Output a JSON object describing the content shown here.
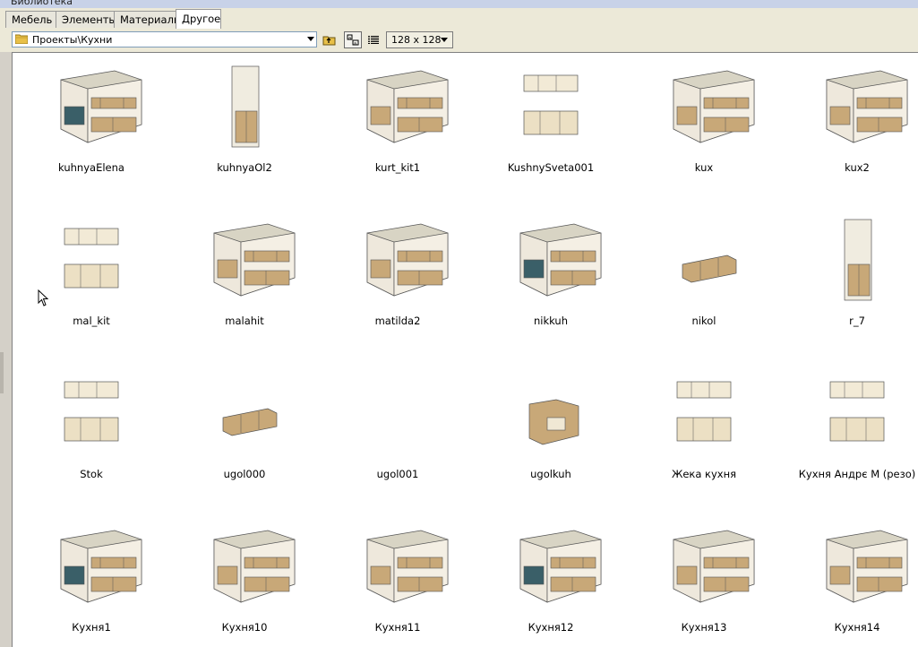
{
  "window": {
    "title": "Библиотека"
  },
  "tabs": [
    {
      "label": "Мебель",
      "active": false
    },
    {
      "label": "Элементы",
      "active": false
    },
    {
      "label": "Материалы",
      "active": false
    },
    {
      "label": "Другое",
      "active": true
    }
  ],
  "toolbar": {
    "path": "Проекты\\Кухни",
    "view_size": "128 x 128",
    "buttons": [
      {
        "icon": "folder-up-icon"
      },
      {
        "icon": "large-icons-view-icon",
        "pressed": true
      },
      {
        "icon": "list-view-icon"
      }
    ]
  },
  "items": [
    {
      "label": "kuhnyaElena"
    },
    {
      "label": "kuhnyaOl2"
    },
    {
      "label": "kurt_kit1"
    },
    {
      "label": "KushnySveta001"
    },
    {
      "label": "kux"
    },
    {
      "label": "kux2"
    },
    {
      "label": "mal_kit"
    },
    {
      "label": "malahit"
    },
    {
      "label": "matilda2"
    },
    {
      "label": "nikkuh"
    },
    {
      "label": "nikol"
    },
    {
      "label": "r_7"
    },
    {
      "label": "Stok"
    },
    {
      "label": "ugol000"
    },
    {
      "label": "ugol001"
    },
    {
      "label": "ugolkuh"
    },
    {
      "label": "Жека кухня"
    },
    {
      "label": "Кухня Андрє М (резо)"
    },
    {
      "label": "Кухня1"
    },
    {
      "label": "Кухня10"
    },
    {
      "label": "Кухня11"
    },
    {
      "label": "Кухня12"
    },
    {
      "label": "Кухня13"
    },
    {
      "label": "Кухня14"
    }
  ],
  "colors": {
    "selection_blue": "#316ac5",
    "wood": "#c8a878",
    "floor": "#d8d4c4"
  }
}
